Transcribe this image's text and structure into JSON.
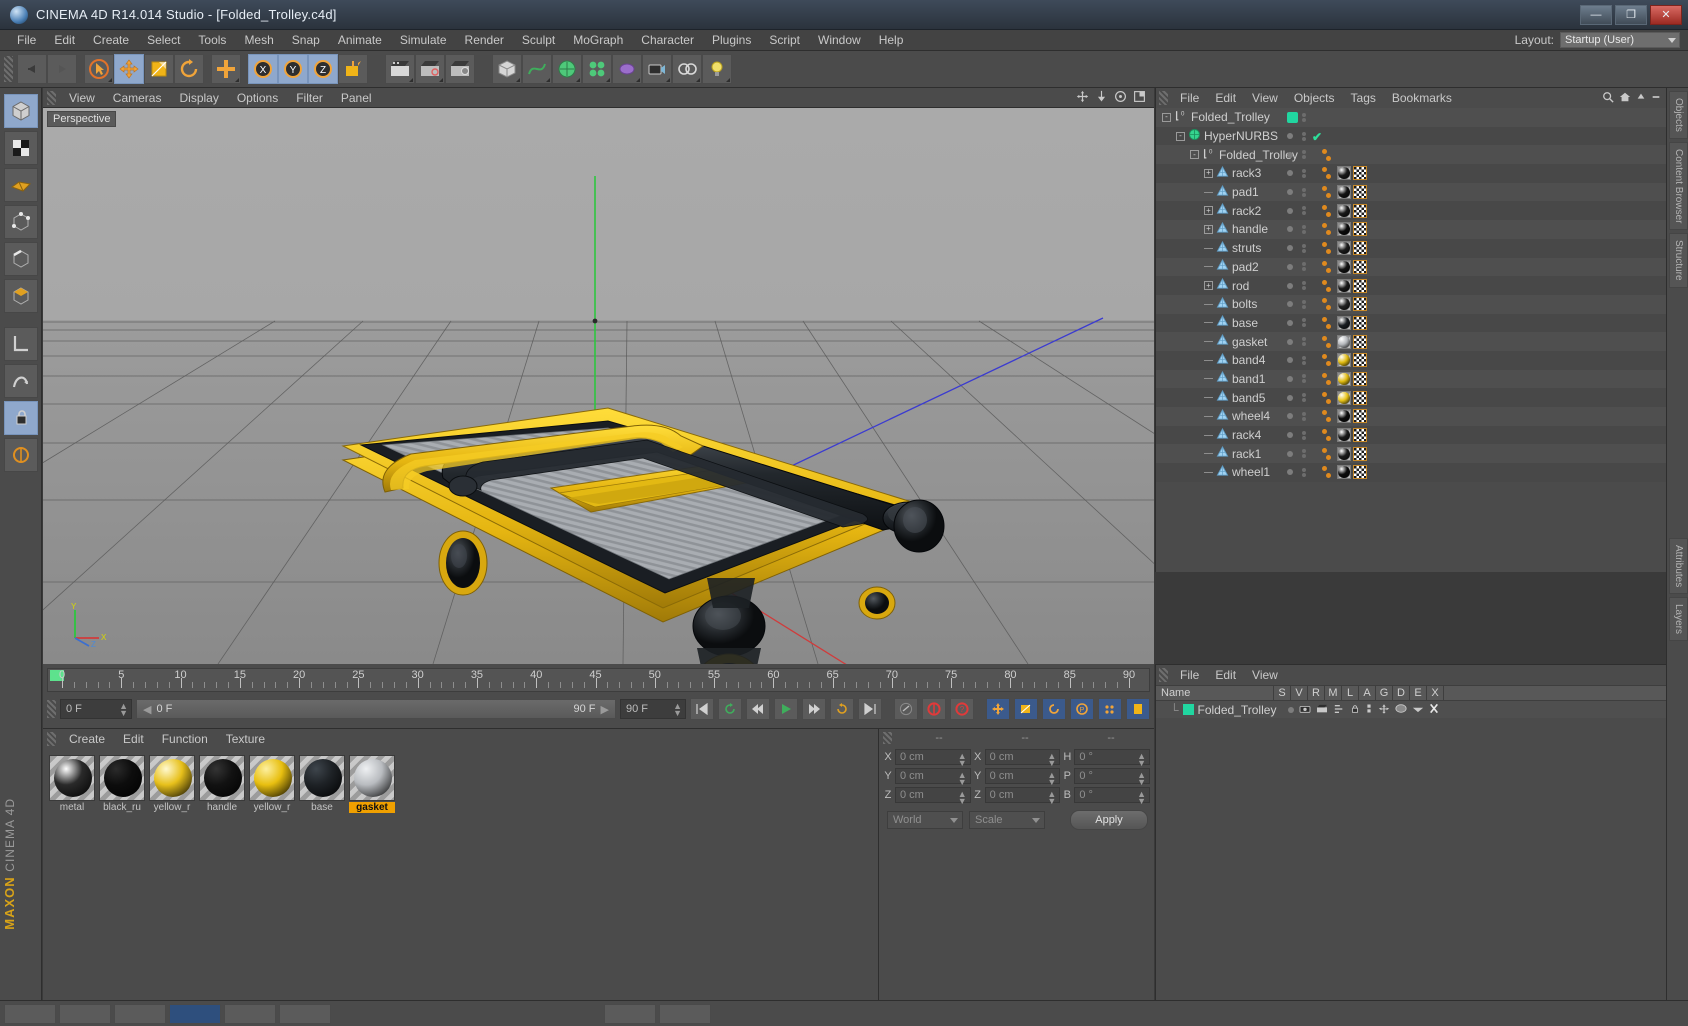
{
  "window": {
    "title": "CINEMA 4D R14.014 Studio - [Folded_Trolley.c4d]",
    "app_icon": "c4d-logo-icon",
    "minimize": "—",
    "maximize": "❐",
    "close": "✕"
  },
  "menubar": {
    "items": [
      "File",
      "Edit",
      "Create",
      "Select",
      "Tools",
      "Mesh",
      "Snap",
      "Animate",
      "Simulate",
      "Render",
      "Sculpt",
      "MoGraph",
      "Character",
      "Plugins",
      "Script",
      "Window",
      "Help"
    ],
    "layout_label": "Layout:",
    "layout_value": "Startup (User)"
  },
  "viewport": {
    "menu": [
      "View",
      "Cameras",
      "Display",
      "Options",
      "Filter",
      "Panel"
    ],
    "label": "Perspective",
    "axis": {
      "x": "X",
      "y": "Y",
      "z": "Z"
    },
    "watermark_top": "MAXON",
    "watermark_bottom": "CINEMA 4D"
  },
  "timeline": {
    "ticks": [
      "0",
      "5",
      "10",
      "15",
      "20",
      "25",
      "30",
      "35",
      "40",
      "45",
      "50",
      "55",
      "60",
      "65",
      "70",
      "75",
      "80",
      "85",
      "90"
    ],
    "current_frame": "0 F",
    "scrub_value": "0 F",
    "range_end": "90 F",
    "end_field": "90 F",
    "frame_right": "0 F"
  },
  "material_manager": {
    "menu": [
      "Create",
      "Edit",
      "Function",
      "Texture"
    ],
    "materials": [
      {
        "name": "metal",
        "color": "#2a2a2a",
        "highlight": "#ffffff",
        "selected": false
      },
      {
        "name": "black_ru",
        "color": "#0d0d0d",
        "highlight": "#2b2b2b",
        "selected": false
      },
      {
        "name": "yellow_r",
        "color": "#e7c01b",
        "highlight": "#fff9d0",
        "selected": false
      },
      {
        "name": "handle",
        "color": "#121212",
        "highlight": "#343434",
        "selected": false
      },
      {
        "name": "yellow_r",
        "color": "#e8bf10",
        "highlight": "#fdf0a0",
        "selected": false
      },
      {
        "name": "base",
        "color": "#1e2226",
        "highlight": "#3e454c",
        "selected": false
      },
      {
        "name": "gasket",
        "color": "#b9bcc0",
        "highlight": "#eef0f2",
        "selected": true
      }
    ]
  },
  "coordinates": {
    "col_headers": [
      "--",
      "--",
      "--"
    ],
    "rows": [
      {
        "l1": "X",
        "v1": "0 cm",
        "l2": "X",
        "v2": "0 cm",
        "l3": "H",
        "v3": "0 °"
      },
      {
        "l1": "Y",
        "v1": "0 cm",
        "l2": "Y",
        "v2": "0 cm",
        "l3": "P",
        "v3": "0 °"
      },
      {
        "l1": "Z",
        "v1": "0 cm",
        "l2": "Z",
        "v2": "0 cm",
        "l3": "B",
        "v3": "0 °"
      }
    ],
    "system": "World",
    "mode": "Scale",
    "apply": "Apply"
  },
  "object_manager": {
    "menu": [
      "File",
      "Edit",
      "View",
      "Objects",
      "Tags",
      "Bookmarks"
    ],
    "tree": [
      {
        "name": "Folded_Trolley",
        "indent": 0,
        "icon": "null-object-icon",
        "expander": "-",
        "dot": "green",
        "tags": []
      },
      {
        "name": "HyperNURBS",
        "indent": 1,
        "icon": "hypernurbs-icon",
        "expander": "-",
        "dot": "gray",
        "check": true,
        "tags": []
      },
      {
        "name": "Folded_Trolley",
        "indent": 2,
        "icon": "null-object-icon",
        "expander": "-",
        "dot": "gray",
        "tags": [
          "dots"
        ]
      },
      {
        "name": "rack3",
        "indent": 3,
        "icon": "polygon-object-icon",
        "expander": "+",
        "dot": "gray",
        "tags": [
          "dots",
          "mat",
          "uv"
        ],
        "mat": "#1a1a1a"
      },
      {
        "name": "pad1",
        "indent": 3,
        "icon": "polygon-object-icon",
        "expander": "",
        "dot": "gray",
        "tags": [
          "dots",
          "mat",
          "uv"
        ],
        "mat": "#141414"
      },
      {
        "name": "rack2",
        "indent": 3,
        "icon": "polygon-object-icon",
        "expander": "+",
        "dot": "gray",
        "tags": [
          "dots",
          "mat",
          "uv"
        ],
        "mat": "#1a1a1a"
      },
      {
        "name": "handle",
        "indent": 3,
        "icon": "polygon-object-icon",
        "expander": "+",
        "dot": "gray",
        "tags": [
          "dots",
          "mat",
          "uv"
        ],
        "mat": "#0b0b0b"
      },
      {
        "name": "struts",
        "indent": 3,
        "icon": "polygon-object-icon",
        "expander": "",
        "dot": "gray",
        "tags": [
          "dots",
          "mat",
          "uv"
        ],
        "mat": "#1c1c1c"
      },
      {
        "name": "pad2",
        "indent": 3,
        "icon": "polygon-object-icon",
        "expander": "",
        "dot": "gray",
        "tags": [
          "dots",
          "mat",
          "uv"
        ],
        "mat": "#141414"
      },
      {
        "name": "rod",
        "indent": 3,
        "icon": "polygon-object-icon",
        "expander": "+",
        "dot": "gray",
        "tags": [
          "dots",
          "mat",
          "uv"
        ],
        "mat": "#1a1a1a"
      },
      {
        "name": "bolts",
        "indent": 3,
        "icon": "polygon-object-icon",
        "expander": "",
        "dot": "gray",
        "tags": [
          "dots",
          "mat",
          "uv"
        ],
        "mat": "#232323"
      },
      {
        "name": "base",
        "indent": 3,
        "icon": "polygon-object-icon",
        "expander": "",
        "dot": "gray",
        "tags": [
          "dots",
          "mat",
          "uv"
        ],
        "mat": "#1a1e22"
      },
      {
        "name": "gasket",
        "indent": 3,
        "icon": "polygon-object-icon",
        "expander": "",
        "dot": "gray",
        "tags": [
          "dots",
          "mat",
          "uv"
        ],
        "mat": "#b4b7bb"
      },
      {
        "name": "band4",
        "indent": 3,
        "icon": "polygon-object-icon",
        "expander": "",
        "dot": "gray",
        "tags": [
          "dots",
          "mat",
          "uv"
        ],
        "mat": "#e0bb10"
      },
      {
        "name": "band1",
        "indent": 3,
        "icon": "polygon-object-icon",
        "expander": "",
        "dot": "gray",
        "tags": [
          "dots",
          "mat",
          "uv"
        ],
        "mat": "#e0bb10"
      },
      {
        "name": "band5",
        "indent": 3,
        "icon": "polygon-object-icon",
        "expander": "",
        "dot": "gray",
        "tags": [
          "dots",
          "mat",
          "uv"
        ],
        "mat": "#e8c41a"
      },
      {
        "name": "wheel4",
        "indent": 3,
        "icon": "polygon-object-icon",
        "expander": "",
        "dot": "gray",
        "tags": [
          "dots",
          "mat",
          "uv"
        ],
        "mat": "#0c0c0c"
      },
      {
        "name": "rack4",
        "indent": 3,
        "icon": "polygon-object-icon",
        "expander": "",
        "dot": "gray",
        "tags": [
          "dots",
          "mat",
          "uv"
        ],
        "mat": "#1a1a1a"
      },
      {
        "name": "rack1",
        "indent": 3,
        "icon": "polygon-object-icon",
        "expander": "",
        "dot": "gray",
        "tags": [
          "dots",
          "mat",
          "uv"
        ],
        "mat": "#1a1a1a"
      },
      {
        "name": "wheel1",
        "indent": 3,
        "icon": "polygon-object-icon",
        "expander": "",
        "dot": "gray",
        "tags": [
          "dots",
          "mat",
          "uv"
        ],
        "mat": "#0c0c0c"
      }
    ]
  },
  "structure_manager": {
    "menu": [
      "File",
      "Edit",
      "View"
    ],
    "columns": [
      "Name",
      "S",
      "V",
      "R",
      "M",
      "L",
      "A",
      "G",
      "D",
      "E",
      "X"
    ],
    "rows": [
      {
        "name": "Folded_Trolley"
      }
    ]
  },
  "right_tabs": [
    "Objects",
    "Content Browser",
    "Structure",
    "Attributes",
    "Layers"
  ],
  "colors": {
    "accent_orange": "#e08a1e",
    "select_blue": "#8fa8cc",
    "green": "#21d6a0",
    "yellow": "#e7c01b",
    "panel_bg": "#4b4b4b"
  }
}
